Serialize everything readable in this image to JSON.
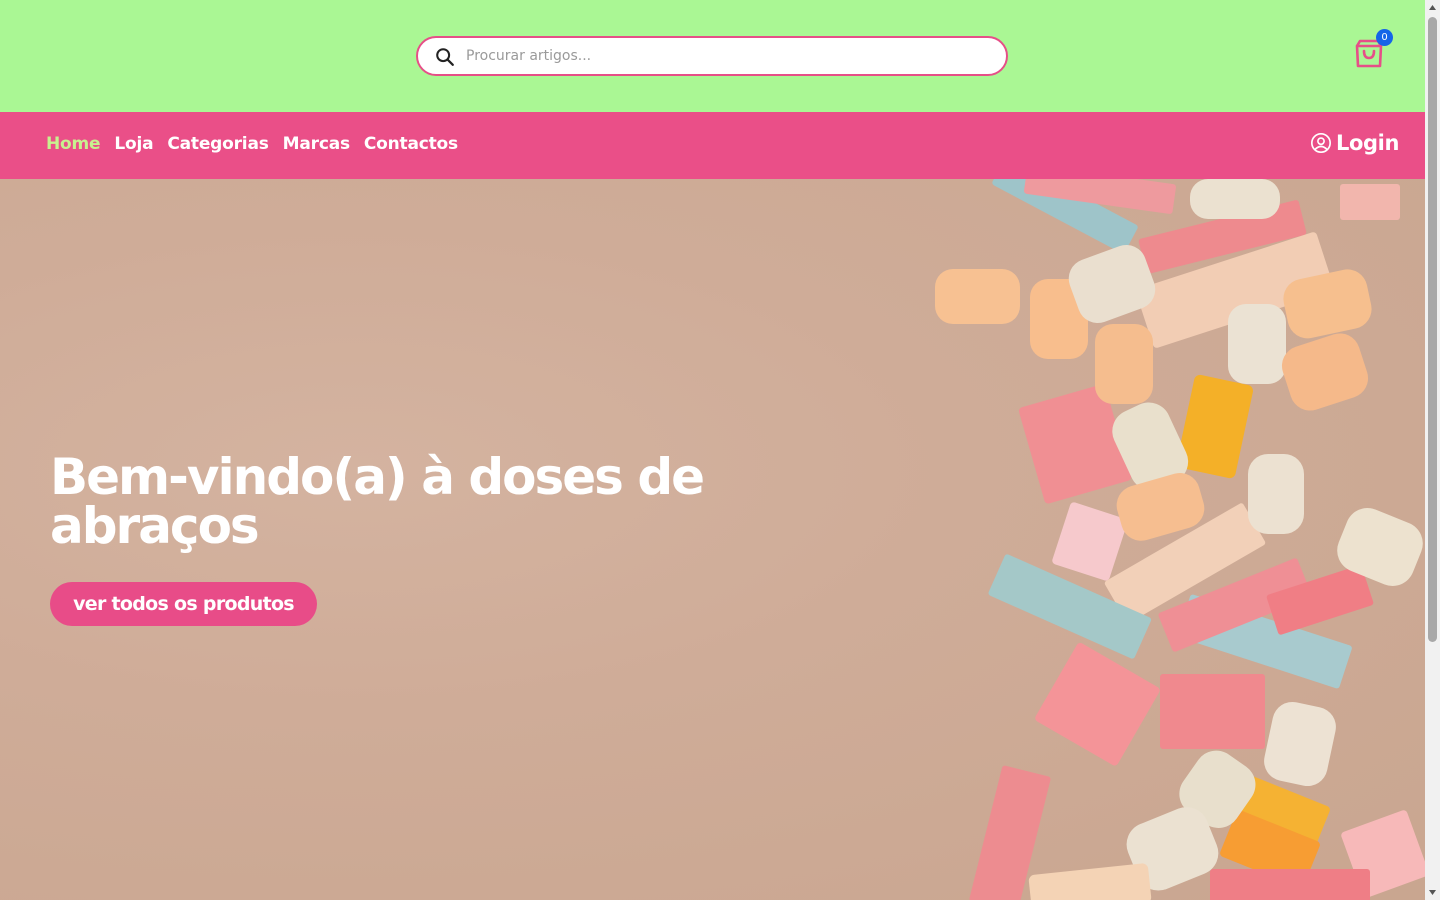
{
  "search": {
    "placeholder": "Procurar artigos..."
  },
  "cart": {
    "count": "0",
    "icon": "shopping-bag-icon"
  },
  "nav": {
    "links": [
      {
        "label": "Home",
        "active": true
      },
      {
        "label": "Loja"
      },
      {
        "label": "Categorias"
      },
      {
        "label": "Marcas"
      },
      {
        "label": "Contactos"
      }
    ],
    "login_label": "Login",
    "login_icon": "user-circle-icon"
  },
  "hero": {
    "title": "Bem-vindo(a) à doses de abraços",
    "cta_label": "ver todos os produtos"
  },
  "colors": {
    "topbar": "#aaf794",
    "nav": "#ea4f88",
    "nav_active": "#c7f28f",
    "accent": "#e84c88",
    "badge": "#1565e8"
  }
}
